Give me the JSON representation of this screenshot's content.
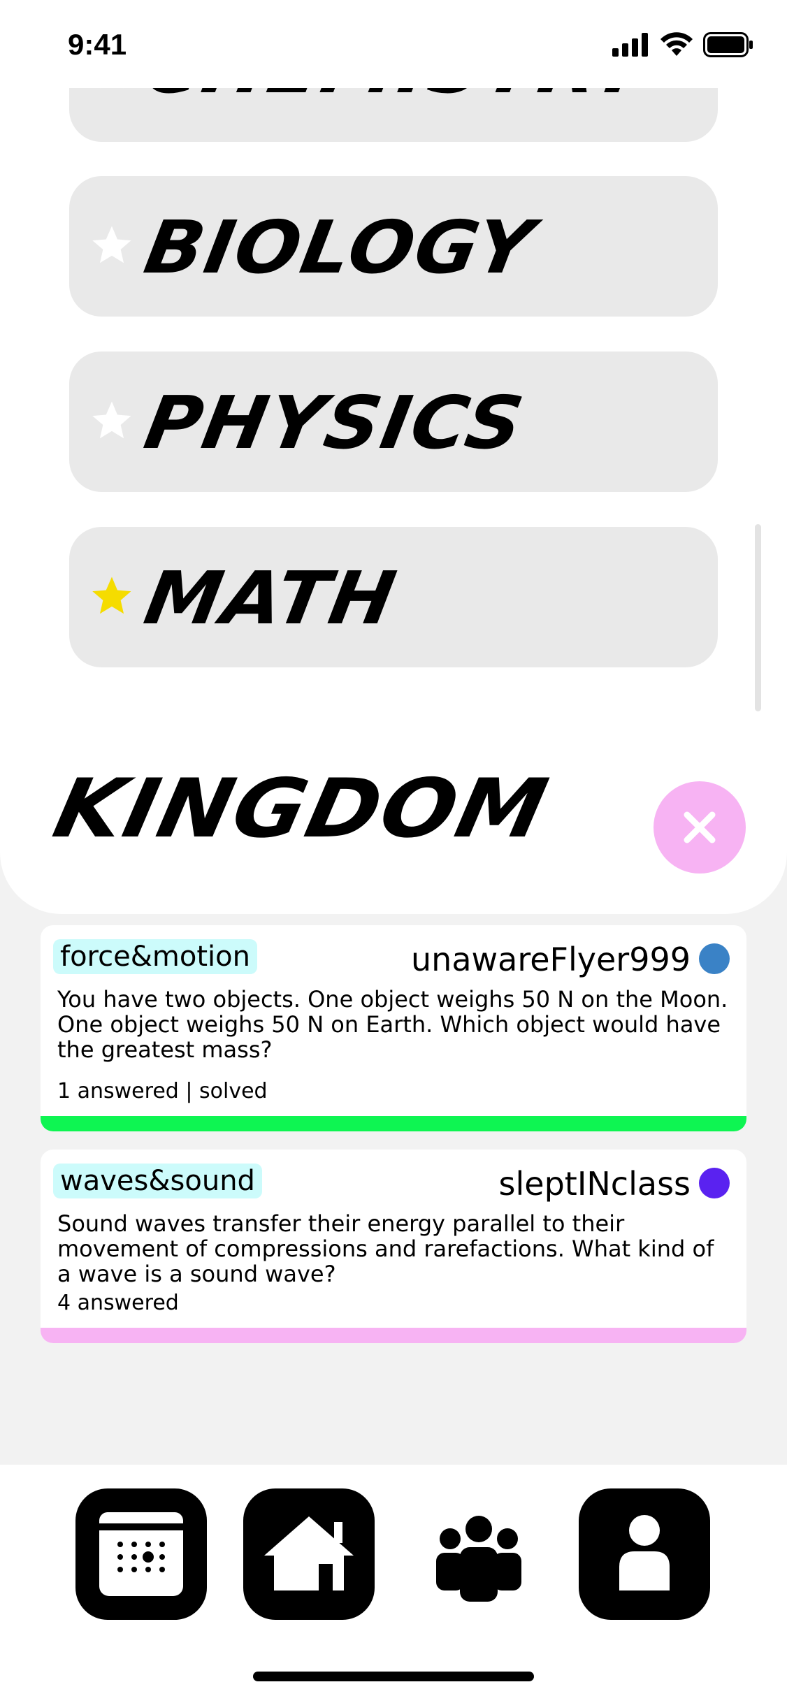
{
  "status_bar": {
    "time": "9:41"
  },
  "subjects": [
    {
      "label": "CHEMISTRY",
      "starred": false
    },
    {
      "label": "BIOLOGY",
      "starred": false
    },
    {
      "label": "PHYSICS",
      "starred": false
    },
    {
      "label": "MATH",
      "starred": true
    }
  ],
  "header": {
    "title": "KINGDOM"
  },
  "questions": [
    {
      "tag": "force&motion",
      "user": "unawareFlyer999",
      "user_color": "#3a82c6",
      "text": "You have two objects. One object weighs 50 N on the Moon. One object weighs 50 N on Earth. Which object would have the greatest mass?",
      "status": "1 answered | solved",
      "bar_color": "#0ef552"
    },
    {
      "tag": "waves&sound",
      "user": "sleptINclass",
      "user_color": "#5a22f0",
      "text": "Sound waves transfer their energy parallel to their movement of compressions and rarefactions. What kind of a wave is a sound wave?",
      "status": "4 answered",
      "bar_color": "#f7b3f3"
    }
  ],
  "nav": {
    "items": [
      "calendar-icon",
      "home-icon",
      "group-icon",
      "profile-icon"
    ]
  },
  "colors": {
    "star_active": "#f5dc00",
    "star_inactive": "#ffffff",
    "close_button": "#f7b3f3",
    "tag_background": "#ccfbfb"
  }
}
